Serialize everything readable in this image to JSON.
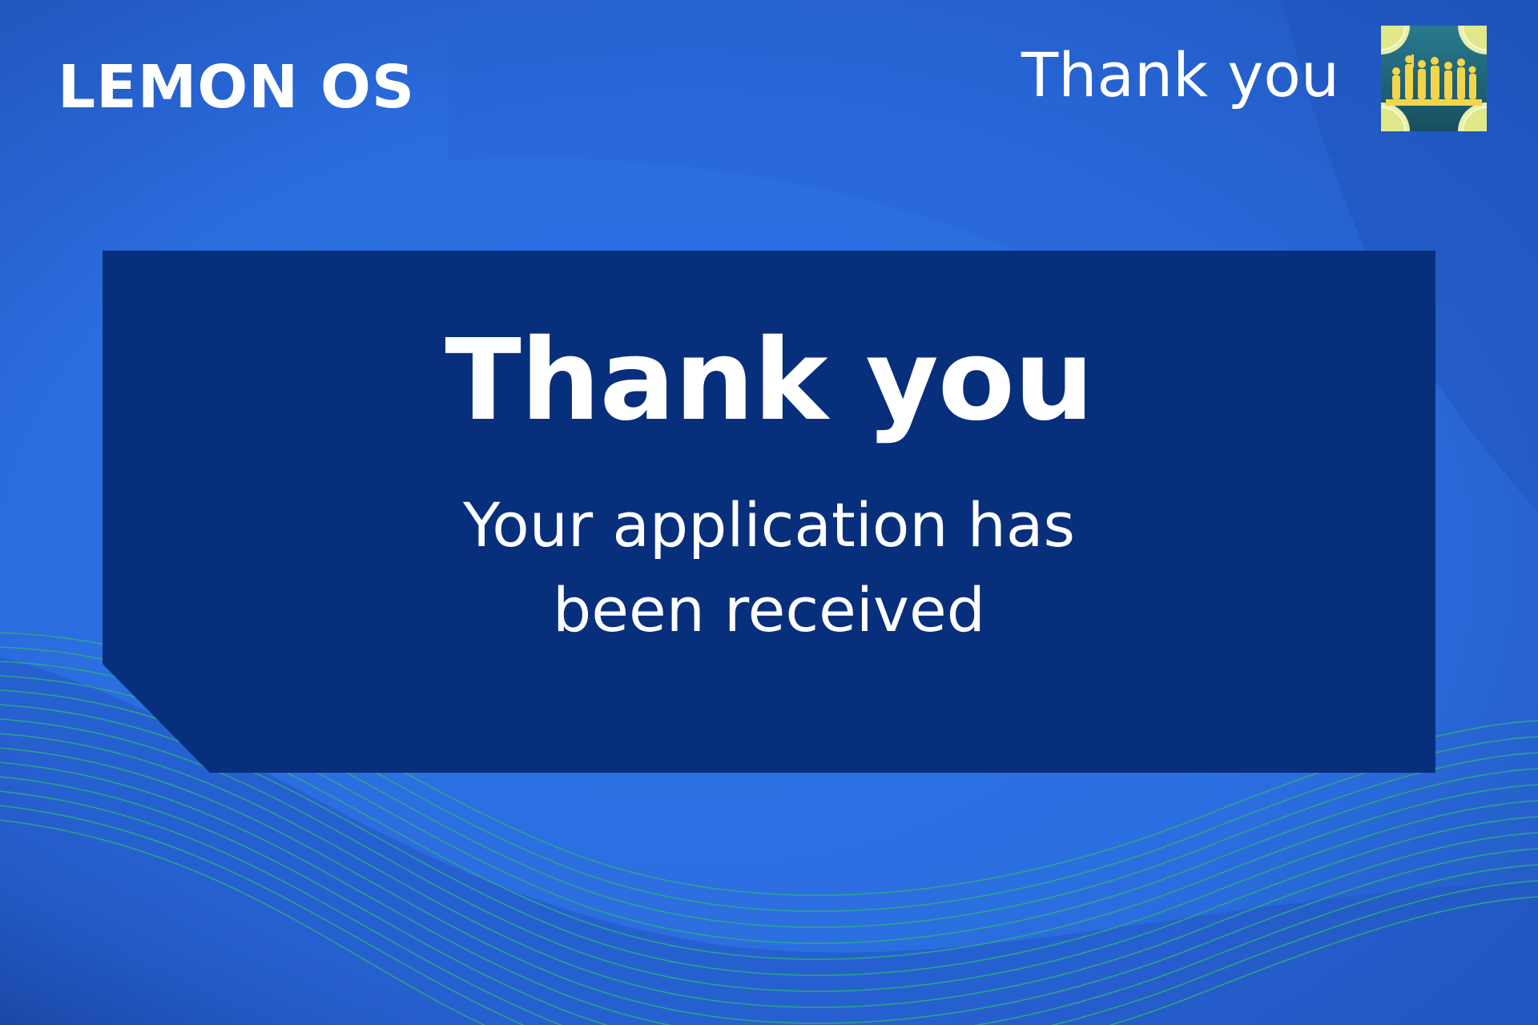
{
  "header": {
    "brand": "LEMON OS",
    "title": "Thank you",
    "badge_icon": "lemon-soldiers-badge-icon"
  },
  "main": {
    "title": "Thank you",
    "message_line1": "Your application has",
    "message_line2": "been received"
  },
  "colors": {
    "background": "#2c6fe0",
    "panel": "#072f7c",
    "text": "#ffffff",
    "wave_lines": "#2fae79",
    "badge_yellow": "#f2d54a",
    "badge_teal": "#1f6f84"
  }
}
